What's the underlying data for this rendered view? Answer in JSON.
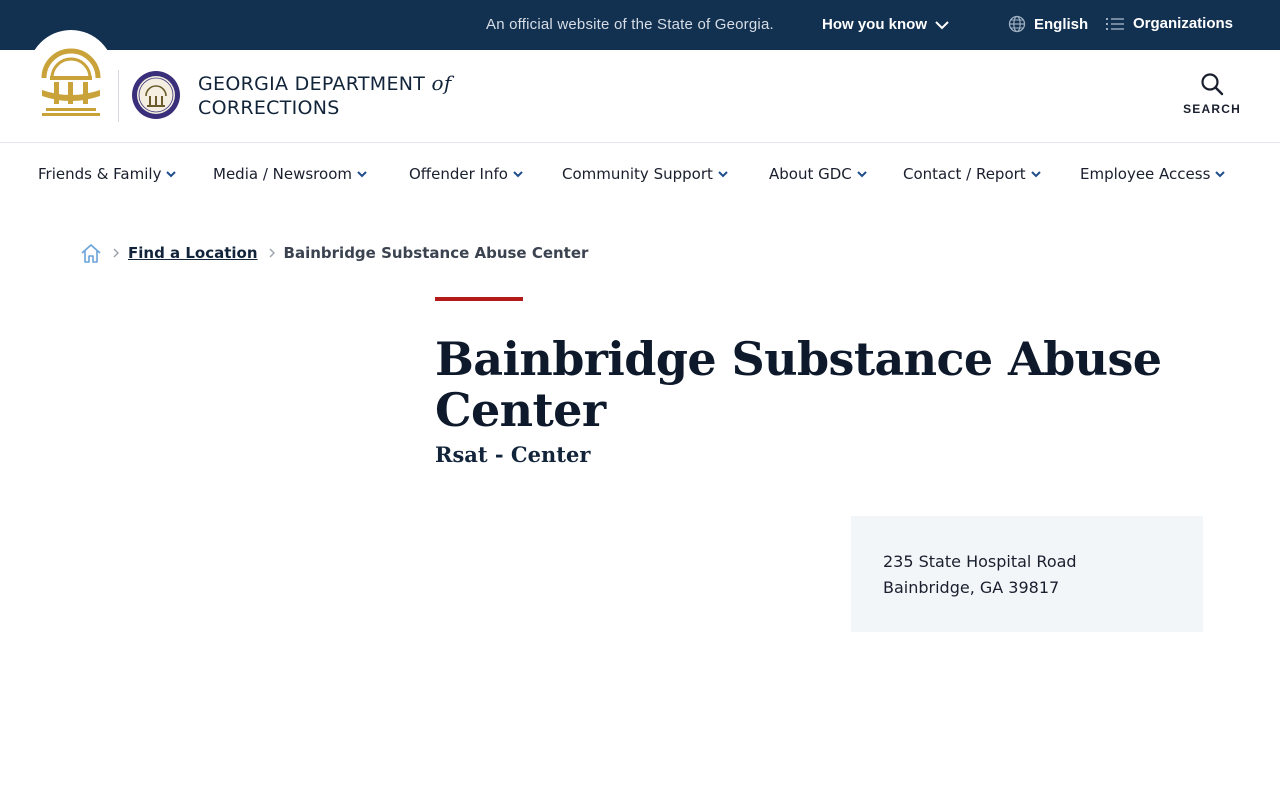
{
  "topbar": {
    "official_text": "An official website of the State of Georgia.",
    "how_you_know": "How you know",
    "language": "English",
    "organizations": "Organizations",
    "background_color": "#12304f"
  },
  "header": {
    "title_line1": "GEORGIA DEPARTMENT",
    "title_of": "of",
    "title_line2": "CORRECTIONS",
    "search_label": "SEARCH",
    "seal_icon": "georgia-state-seal-icon",
    "dept_seal_icon": "department-of-corrections-seal-icon",
    "gold_color": "#c9a23a",
    "seal_purple": "#3a2f7a"
  },
  "nav": {
    "items": [
      {
        "label": "Friends & Family"
      },
      {
        "label": "Media / Newsroom"
      },
      {
        "label": "Offender Info"
      },
      {
        "label": "Community Support"
      },
      {
        "label": "About GDC"
      },
      {
        "label": "Contact / Report"
      },
      {
        "label": "Employee Access"
      }
    ],
    "chevron_color": "#1f4e8c"
  },
  "breadcrumb": {
    "home_icon": "home-icon",
    "link": "Find a Location",
    "current": "Bainbridge Substance Abuse Center"
  },
  "page": {
    "title": "Bainbridge Substance Abuse Center",
    "subtitle": "Rsat - Center",
    "accent_color": "#b31b1b"
  },
  "address": {
    "line1": "235 State Hospital Road",
    "line2": "Bainbridge, GA 39817"
  }
}
